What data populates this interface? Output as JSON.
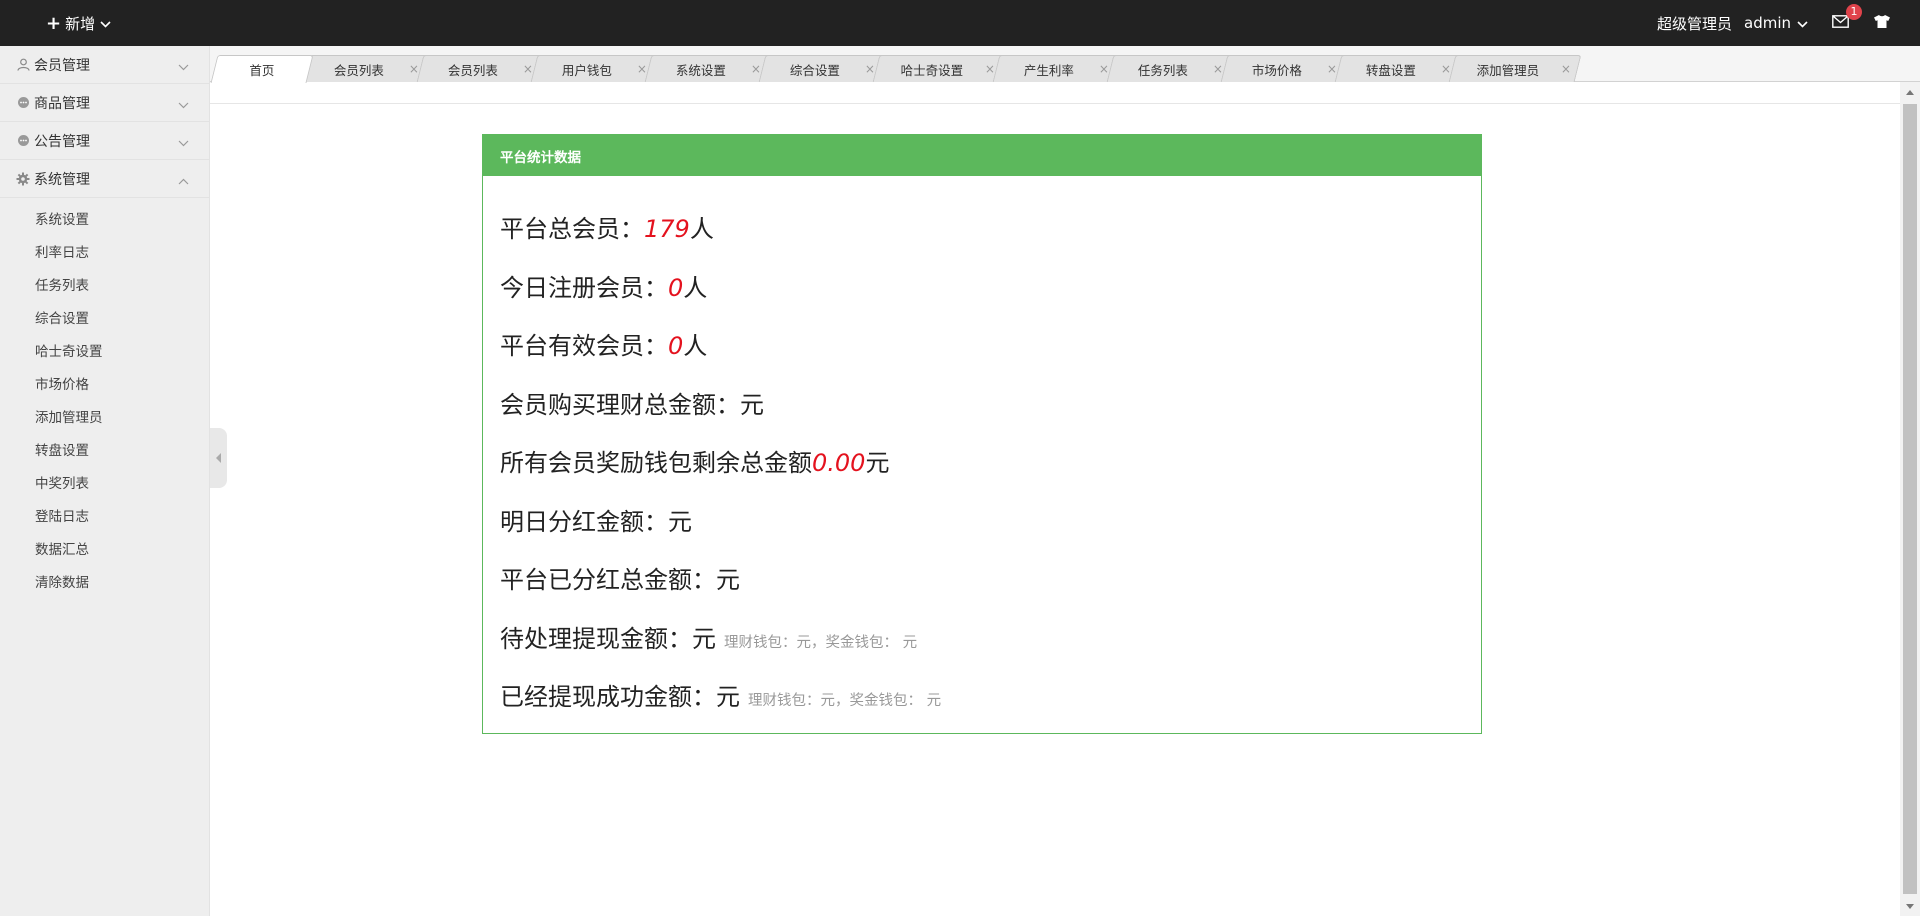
{
  "topbar": {
    "new_label": "新增",
    "role": "超级管理员",
    "user": "admin",
    "message_count": "1"
  },
  "sidebar": {
    "groups": [
      {
        "label": "会员管理",
        "icon": "user-icon",
        "expanded": false
      },
      {
        "label": "商品管理",
        "icon": "chat-icon",
        "expanded": false
      },
      {
        "label": "公告管理",
        "icon": "chat-icon",
        "expanded": false
      },
      {
        "label": "系统管理",
        "icon": "gear-icon",
        "expanded": true
      }
    ],
    "system_items": [
      "系统设置",
      "利率日志",
      "任务列表",
      "综合设置",
      "哈士奇设置",
      "市场价格",
      "添加管理员",
      "转盘设置",
      "中奖列表",
      "登陆日志",
      "数据汇总",
      "清除数据"
    ]
  },
  "tabs": [
    {
      "label": "首页",
      "active": true
    },
    {
      "label": "会员列表"
    },
    {
      "label": "会员列表"
    },
    {
      "label": "用户钱包"
    },
    {
      "label": "系统设置"
    },
    {
      "label": "综合设置"
    },
    {
      "label": "哈士奇设置"
    },
    {
      "label": "产生利率"
    },
    {
      "label": "任务列表"
    },
    {
      "label": "市场价格"
    },
    {
      "label": "转盘设置"
    },
    {
      "label": "添加管理员"
    }
  ],
  "tab_close_glyph": "×",
  "panel": {
    "title": "平台统计数据",
    "stats": [
      {
        "label": "平台总会员：",
        "value": "179",
        "unit": "人",
        "note": ""
      },
      {
        "label": "今日注册会员：",
        "value": "0",
        "unit": "人",
        "note": ""
      },
      {
        "label": "平台有效会员：",
        "value": "0",
        "unit": "人",
        "note": ""
      },
      {
        "label": "会员购买理财总金额：",
        "value": "",
        "unit": "元",
        "note": ""
      },
      {
        "label": "所有会员奖励钱包剩余总金额",
        "value": "0.00",
        "unit": "元",
        "note": ""
      },
      {
        "label": "明日分红金额：",
        "value": "",
        "unit": "元",
        "note": ""
      },
      {
        "label": "平台已分红总金额：",
        "value": "",
        "unit": "元",
        "note": ""
      },
      {
        "label": "待处理提现金额：",
        "value": "",
        "unit": "元",
        "note": "理财钱包：元，奖金钱包： 元"
      },
      {
        "label": "已经提现成功金额：",
        "value": "",
        "unit": "元",
        "note": "理财钱包：元，奖金钱包： 元"
      }
    ]
  },
  "colors": {
    "topbar": "#222222",
    "panel_accent": "#5cb85c",
    "value_red": "#e4121e",
    "badge": "#e0434b"
  }
}
